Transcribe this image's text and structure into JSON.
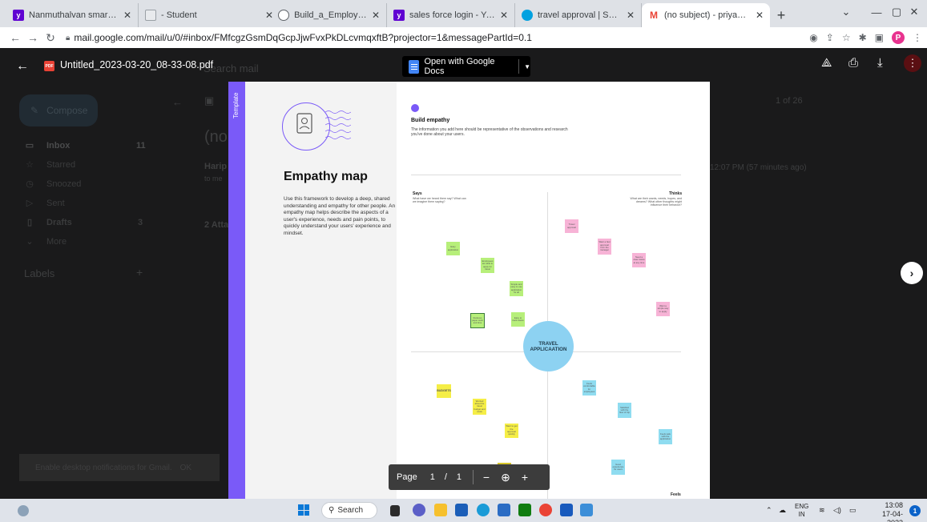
{
  "browser": {
    "tabs": [
      {
        "title": "Nanmuthalvan smartinternz",
        "favicon": "yahoo-icon",
        "color": "#6001d2"
      },
      {
        "title": "- Student",
        "favicon": "page-icon",
        "color": "#9aa0a6"
      },
      {
        "title": "Build_a_Employee_Travel_A",
        "favicon": "globe-icon",
        "color": "#5f6368"
      },
      {
        "title": "sales force login - Yahoo In",
        "favicon": "yahoo-icon",
        "color": "#6001d2"
      },
      {
        "title": "travel approval | Salesforce",
        "favicon": "salesforce-icon",
        "color": "#00a1e0"
      },
      {
        "title": "(no subject) - priyadharshi",
        "favicon": "gmail-icon",
        "color": "#ea4335"
      }
    ],
    "url": "mail.google.com/mail/u/0/#inbox/FMfcgzGsmDqGcpJjwFvxPkDLcvmqxftB?projector=1&messagePartId=0.1",
    "profile_initial": "P"
  },
  "gmail": {
    "search_placeholder": "Search mail",
    "compose_label": "Compose",
    "nav": [
      {
        "label": "Inbox",
        "count": "11"
      },
      {
        "label": "Starred",
        "count": ""
      },
      {
        "label": "Snoozed",
        "count": ""
      },
      {
        "label": "Sent",
        "count": ""
      },
      {
        "label": "Drafts",
        "count": "3"
      },
      {
        "label": "More",
        "count": ""
      }
    ],
    "labels_heading": "Labels",
    "pagination": "1 of 26",
    "subject_fragment": "(no",
    "sender_fragment": "Harip",
    "to_fragment": "to me",
    "timestamp": "12:07 PM (57 minutes ago)",
    "attachments_fragment": "2 Atta",
    "notification": "Enable desktop notifications for Gmail.",
    "notification_ok": "OK"
  },
  "viewer": {
    "filename": "Untitled_2023-03-20_08-33-08.pdf",
    "pdf_badge": "PDF",
    "open_with_label": "Open with Google Docs",
    "page_label": "Page",
    "page_current": "1",
    "page_separator": "/",
    "page_total": "1"
  },
  "document": {
    "template_tag": "Template",
    "title": "Empathy map",
    "description": "Use this framework to develop a deep, shared understanding and empathy for other people. An empathy map helps describe the aspects of a user's experience, needs and pain points, to quickly understand your users' experience and mindset.",
    "section_title": "Build empathy",
    "section_desc": "The information you add here should be representative of the observations and research you've done about your users.",
    "says_label": "Says",
    "says_sub": "What have we heard them say? What can we imagine them saying?",
    "thinks_label": "Thinks",
    "thinks_sub": "What are their wants, needs, hopes, and dreams? What other thoughts might influence their behavior?",
    "feels_label": "Feels",
    "center_line1": "TRAVEL",
    "center_line2": "APPLICAATION",
    "stickies": {
      "g1": "Easy application",
      "g2": "Employees are able to apply for travel",
      "g3": "Simple and easy to use application for all",
      "g4": "Reduces paper work and time",
      "g5": "Easy to track status",
      "p1": "Travel approval",
      "p2": "Want a fast approval from the manager",
      "p3": "Need a clear status at any time",
      "p4": "Want a simple way to apply",
      "y1": "BUDGETS",
      "y2": "Worried about the travel budget and costs",
      "y3": "Want to get the approval quickly",
      "b1": "Feels comfortable for employees",
      "b2": "Satisfied with the flow of trip",
      "b3": "Feels safe with the application",
      "b4": "Good experience for users"
    }
  },
  "taskbar": {
    "search_label": "Search",
    "lang_line1": "ENG",
    "lang_line2": "IN",
    "time": "13:08",
    "date": "17-04-2023",
    "notification_count": "1"
  }
}
